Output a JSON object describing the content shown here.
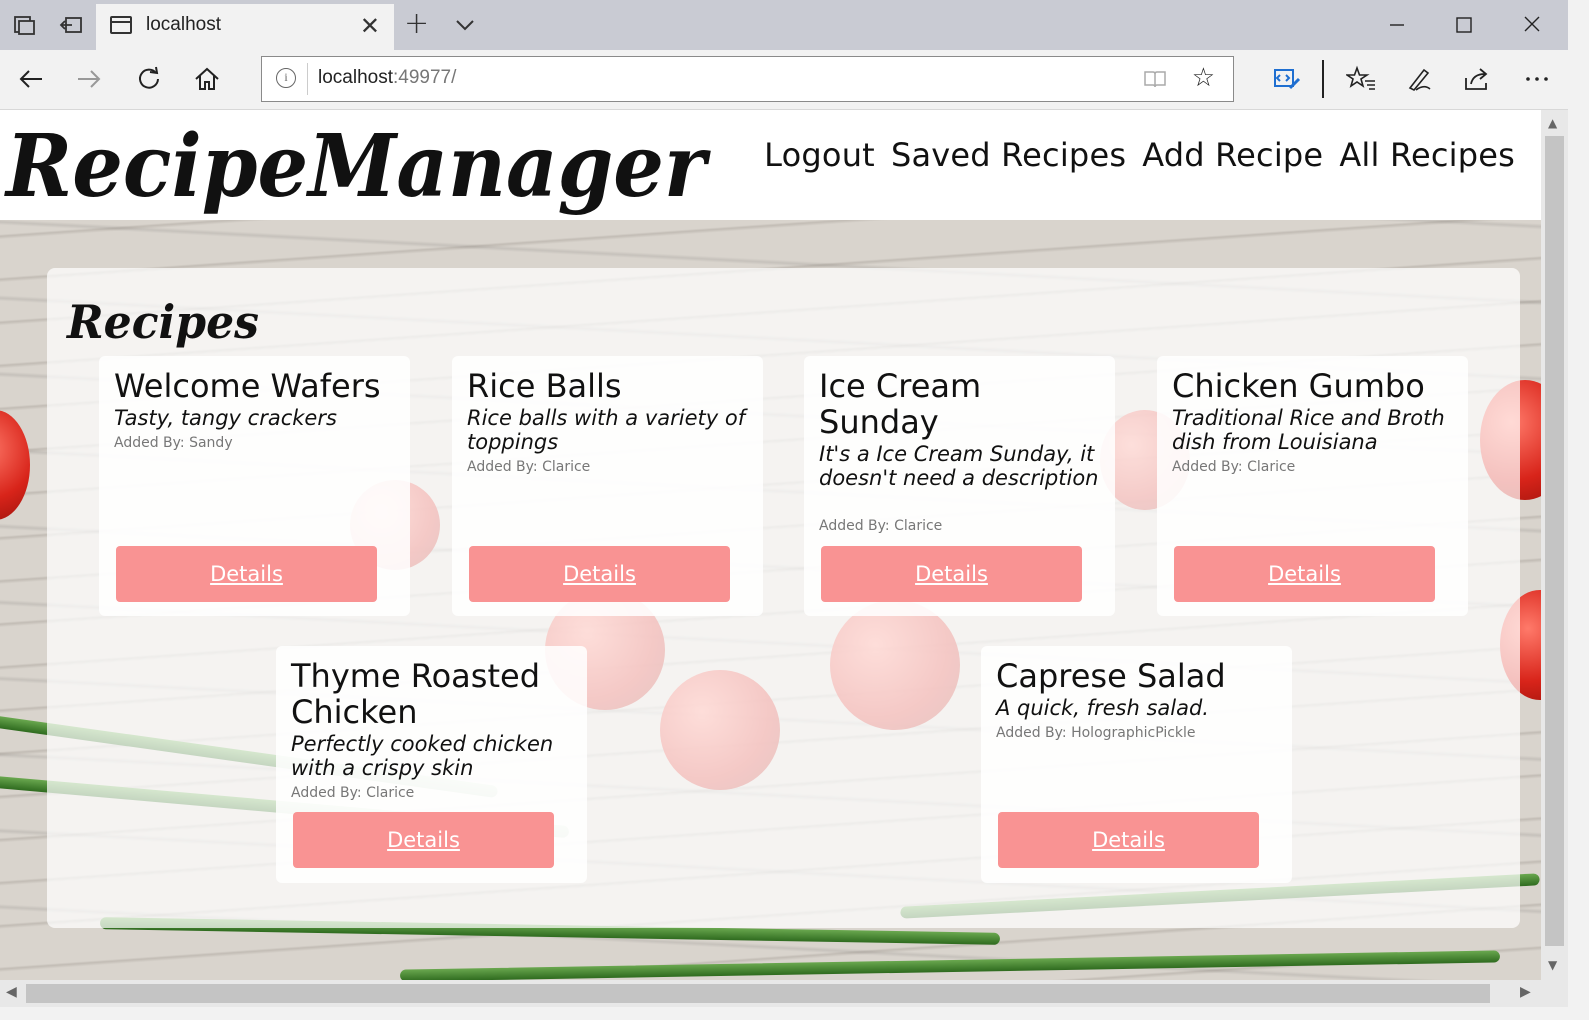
{
  "browser": {
    "tab_title": "localhost",
    "url_host": "localhost",
    "url_rest": ":49977/",
    "icons": {
      "tab_list": "tab-list-icon",
      "tab_back": "set-aside-tabs-icon",
      "page": "page-icon",
      "close": "close-icon",
      "new_tab": "plus-icon",
      "tab_menu": "chevron-down-icon",
      "back": "back-arrow-icon",
      "forward": "forward-arrow-icon",
      "refresh": "refresh-icon",
      "home": "home-icon",
      "info": "info-icon",
      "reader": "reading-view-icon",
      "favorite": "star-icon",
      "devtools": "developer-tools-icon",
      "favorites": "favorites-list-icon",
      "notes": "pen-icon",
      "share": "share-icon",
      "more": "more-icon"
    }
  },
  "site": {
    "logo_text": "RecipeManager",
    "nav": [
      {
        "label": "Logout"
      },
      {
        "label": "Saved Recipes"
      },
      {
        "label": "Add Recipe"
      },
      {
        "label": "All Recipes"
      }
    ],
    "section_title": "Recipes",
    "details_label": "Details",
    "accent_color": "#f99393"
  },
  "recipes": [
    {
      "name": "Welcome Wafers",
      "description": "Tasty, tangy crackers",
      "author": "Added By: Sandy"
    },
    {
      "name": "Rice Balls",
      "description": "Rice balls with a variety of toppings",
      "author": "Added By: Clarice"
    },
    {
      "name": "Ice Cream Sunday",
      "description": "It's a Ice Cream Sunday, it doesn't need a description",
      "author": "Added By: Clarice"
    },
    {
      "name": "Chicken Gumbo",
      "description": "Traditional Rice and Broth dish from Louisiana",
      "author": "Added By: Clarice"
    },
    {
      "name": "Thyme Roasted Chicken",
      "description": "Perfectly cooked chicken with a crispy skin",
      "author": "Added By: Clarice"
    },
    {
      "name": "Caprese Salad",
      "description": "A quick, fresh salad.",
      "author": "Added By: HolographicPickle"
    }
  ]
}
